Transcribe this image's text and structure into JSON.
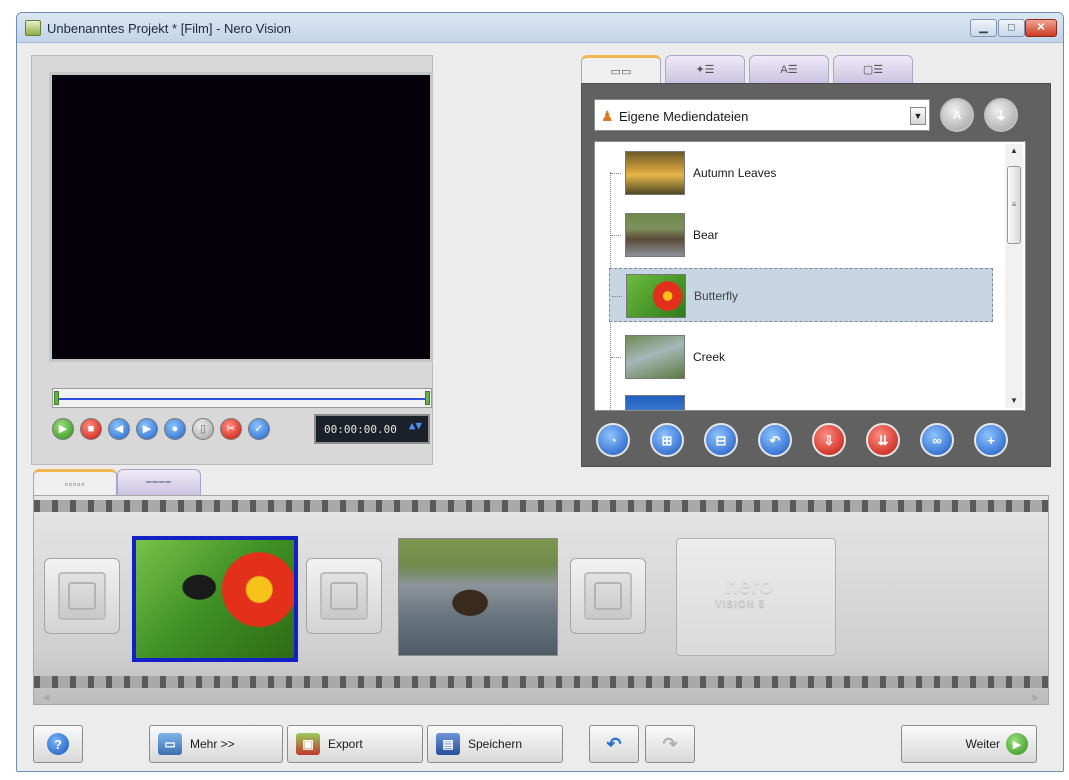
{
  "window": {
    "title": "Unbenanntes Projekt * [Film] - Nero Vision",
    "min_glyph": "▁",
    "max_glyph": "□",
    "close_glyph": "✕"
  },
  "player": {
    "timecode": "00:00:00.00",
    "spin_glyph": "▲▼",
    "buttons": [
      {
        "name": "play-button",
        "glyph": "▶",
        "color": "green"
      },
      {
        "name": "stop-button",
        "glyph": "■",
        "color": "red"
      },
      {
        "name": "prev-frame-button",
        "glyph": "◀",
        "color": "blue"
      },
      {
        "name": "next-frame-button",
        "glyph": "▶",
        "color": "blue"
      },
      {
        "name": "snapshot-button",
        "glyph": "●",
        "color": "blue"
      },
      {
        "name": "split-button",
        "glyph": "▯",
        "color": "gray"
      },
      {
        "name": "cut-button",
        "glyph": "✂",
        "color": "red"
      },
      {
        "name": "check-button",
        "glyph": "✓",
        "color": "blue"
      }
    ]
  },
  "media_tabs": [
    {
      "label": "▭▭",
      "active": true
    },
    {
      "label": "✦☰",
      "active": false
    },
    {
      "label": "A☰",
      "active": false
    },
    {
      "label": "▢☰",
      "active": false
    }
  ],
  "media_browser": {
    "folder": "Eigene Mediendateien",
    "folder_icon": "user-folder-icon",
    "dropdown_arrow": "▼",
    "btn_a_glyph": "A",
    "btn_b_glyph": "⏚",
    "items": [
      {
        "label": "Autumn Leaves",
        "selected": false
      },
      {
        "label": "Bear",
        "selected": false
      },
      {
        "label": "Butterfly",
        "selected": true
      },
      {
        "label": "Creek",
        "selected": false
      },
      {
        "label": "",
        "selected": false
      }
    ],
    "scroll_up": "▲",
    "scroll_down": "▼",
    "scroll_grip": "≡",
    "tools": [
      {
        "name": "play-media-button",
        "glyph": "◔",
        "color": "blue"
      },
      {
        "name": "chapter-button",
        "glyph": "⊞",
        "color": "blue"
      },
      {
        "name": "disc-button",
        "glyph": "⊟",
        "color": "blue"
      },
      {
        "name": "undo-media-button",
        "glyph": "↶",
        "color": "blue"
      },
      {
        "name": "import-button",
        "glyph": "⇩",
        "color": "red"
      },
      {
        "name": "capture-button",
        "glyph": "⇊",
        "color": "red"
      },
      {
        "name": "link-button",
        "glyph": "∞",
        "color": "blue"
      },
      {
        "name": "add-media-button",
        "glyph": "+",
        "color": "blue"
      }
    ]
  },
  "timeline": {
    "tabs": [
      {
        "label": "▫▫▫▫▫",
        "active": true
      },
      {
        "label": "━━━━",
        "active": false
      }
    ],
    "placeholder_logo_top": "nero",
    "placeholder_logo_bottom": "VISION 5",
    "scroll_left": "◀",
    "scroll_right": "▶"
  },
  "bottom_bar": {
    "help_glyph": "?",
    "more_label": "Mehr >>",
    "export_label": "Export",
    "save_label": "Speichern",
    "undo_glyph": "↶",
    "redo_glyph": "↷",
    "next_label": "Weiter",
    "next_glyph": "▶"
  }
}
